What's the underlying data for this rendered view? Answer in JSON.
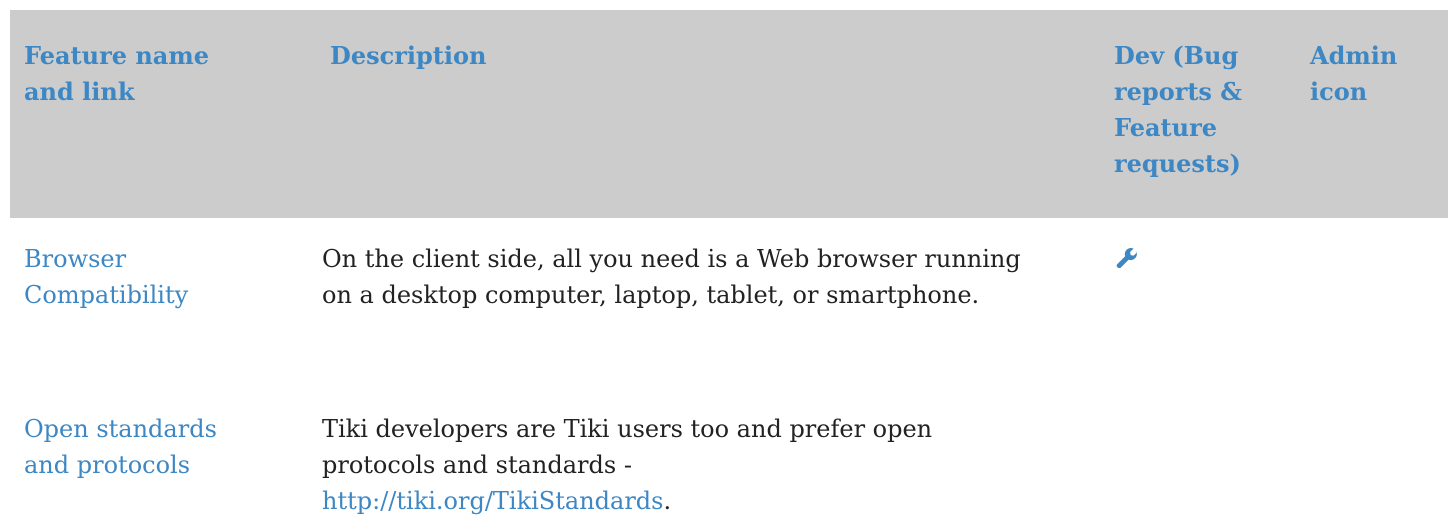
{
  "table": {
    "headers": {
      "feature": "Feature name and link",
      "description": "Description",
      "dev": "Dev (Bug reports & Feature requests)",
      "admin": "Admin icon"
    },
    "rows": [
      {
        "feature": "Browser Compatibility",
        "description": "On the client side, all you need is a Web browser running on a desktop computer, laptop, tablet, or smartphone.",
        "dev_icon": "wrench-icon"
      },
      {
        "feature": "Open standards and protocols",
        "description_text": "Tiki developers are Tiki users too and prefer open protocols and standards -",
        "description_link": "http://tiki.org/TikiStandards",
        "description_suffix": "."
      }
    ]
  },
  "colors": {
    "header_bg": "#cccccc",
    "link": "#3d87c4",
    "text": "#222222"
  }
}
